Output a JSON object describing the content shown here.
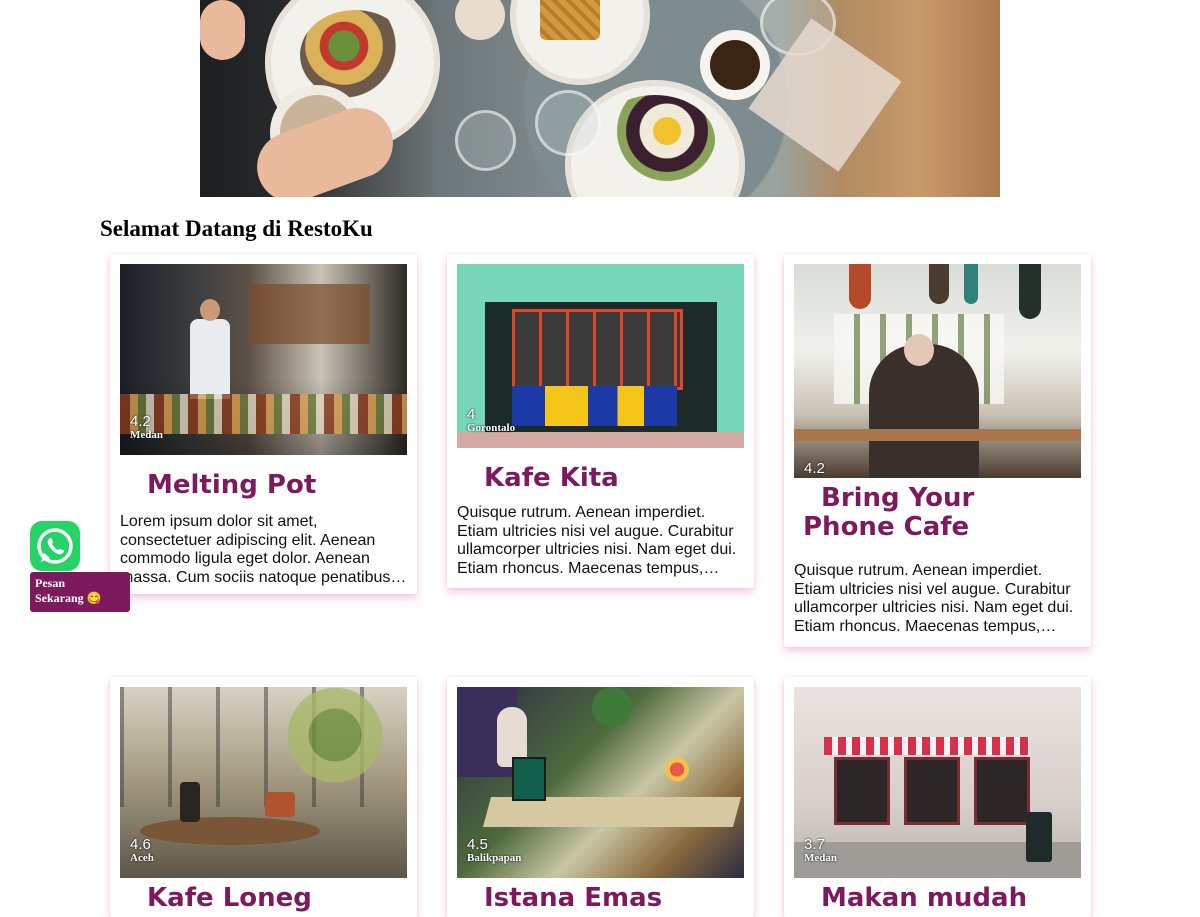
{
  "welcome_title": "Selamat Datang di RestoKu",
  "colors": {
    "accent": "#7d1a5e",
    "whatsapp": "#25d366",
    "card_shadow": "#ee82be"
  },
  "whatsapp": {
    "icon": "whatsapp-icon",
    "label_line1": "Pesan",
    "label_line2": "Sekarang 😋"
  },
  "cards": [
    {
      "rating": "4.2",
      "city": "Medan",
      "name": "Melting Pot",
      "description": "Lorem ipsum dolor sit amet, consectetuer adipiscing elit. Aenean commodo ligula eget dolor. Aenean massa. Cum sociis natoque penatibus et magnis dis parturient montes."
    },
    {
      "rating": "4",
      "city": "Gorontalo",
      "name": "Kafe Kita",
      "description": "Quisque rutrum. Aenean imperdiet. Etiam ultricies nisi vel augue. Curabitur ullamcorper ultricies nisi. Nam eget dui. Etiam rhoncus. Maecenas tempus, tellus eget condimentum."
    },
    {
      "rating": "4.2",
      "city": "",
      "name": "Bring Your Phone Cafe",
      "description": "Quisque rutrum. Aenean imperdiet. Etiam ultricies nisi vel augue. Curabitur ullamcorper ultricies nisi. Nam eget dui. Etiam rhoncus. Maecenas tempus, tellus eget condimentum."
    },
    {
      "rating": "4.6",
      "city": "Aceh",
      "name": "Kafe Loneg",
      "description": ""
    },
    {
      "rating": "4.5",
      "city": "Balikpapan",
      "name": "Istana Emas",
      "description": ""
    },
    {
      "rating": "3.7",
      "city": "Medan",
      "name": "Makan mudah",
      "description": ""
    }
  ]
}
